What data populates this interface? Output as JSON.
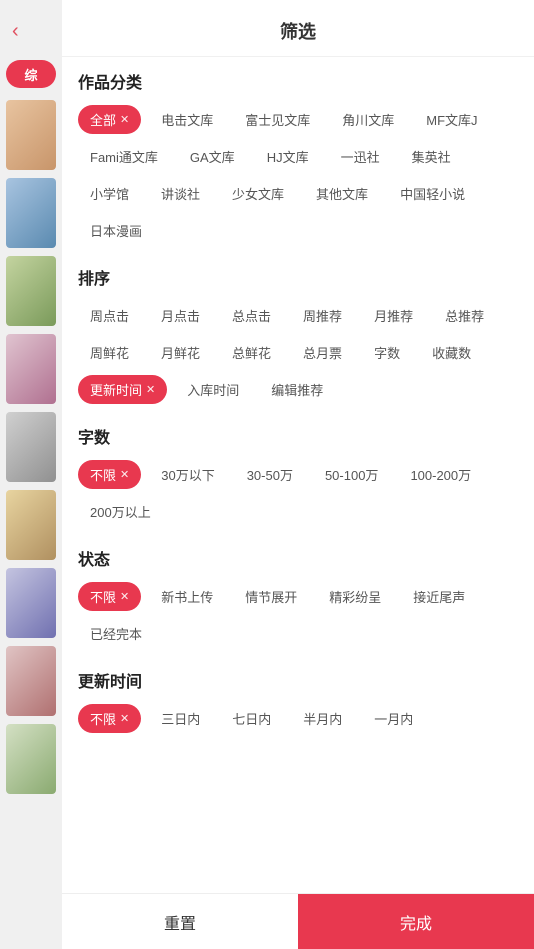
{
  "header": {
    "title": "筛选",
    "back_icon": "‹"
  },
  "sections": {
    "category": {
      "title": "作品分类",
      "tags": [
        {
          "label": "全部",
          "active": true,
          "showClose": true
        },
        {
          "label": "电击文库",
          "active": false
        },
        {
          "label": "富士见文库",
          "active": false
        },
        {
          "label": "角川文库",
          "active": false
        },
        {
          "label": "MF文库J",
          "active": false
        },
        {
          "label": "Fami通文库",
          "active": false
        },
        {
          "label": "GA文库",
          "active": false
        },
        {
          "label": "HJ文库",
          "active": false
        },
        {
          "label": "一迅社",
          "active": false
        },
        {
          "label": "集英社",
          "active": false
        },
        {
          "label": "小学馆",
          "active": false
        },
        {
          "label": "讲谈社",
          "active": false
        },
        {
          "label": "少女文库",
          "active": false
        },
        {
          "label": "其他文库",
          "active": false
        },
        {
          "label": "中国轻小说",
          "active": false
        },
        {
          "label": "日本漫画",
          "active": false
        }
      ]
    },
    "sort": {
      "title": "排序",
      "tags": [
        {
          "label": "周点击",
          "active": false
        },
        {
          "label": "月点击",
          "active": false
        },
        {
          "label": "总点击",
          "active": false
        },
        {
          "label": "周推荐",
          "active": false
        },
        {
          "label": "月推荐",
          "active": false
        },
        {
          "label": "总推荐",
          "active": false
        },
        {
          "label": "周鲜花",
          "active": false
        },
        {
          "label": "月鲜花",
          "active": false
        },
        {
          "label": "总鲜花",
          "active": false
        },
        {
          "label": "总月票",
          "active": false
        },
        {
          "label": "字数",
          "active": false
        },
        {
          "label": "收藏数",
          "active": false
        },
        {
          "label": "更新时间",
          "active": true,
          "showClose": true
        },
        {
          "label": "入库时间",
          "active": false
        },
        {
          "label": "编辑推荐",
          "active": false
        }
      ]
    },
    "wordcount": {
      "title": "字数",
      "tags": [
        {
          "label": "不限",
          "active": true,
          "showClose": true
        },
        {
          "label": "30万以下",
          "active": false
        },
        {
          "label": "30-50万",
          "active": false
        },
        {
          "label": "50-100万",
          "active": false
        },
        {
          "label": "100-200万",
          "active": false
        },
        {
          "label": "200万以上",
          "active": false
        }
      ]
    },
    "status": {
      "title": "状态",
      "tags": [
        {
          "label": "不限",
          "active": true,
          "showClose": true
        },
        {
          "label": "新书上传",
          "active": false
        },
        {
          "label": "情节展开",
          "active": false
        },
        {
          "label": "精彩纷呈",
          "active": false
        },
        {
          "label": "接近尾声",
          "active": false
        },
        {
          "label": "已经完本",
          "active": false
        }
      ]
    },
    "updatetime": {
      "title": "更新时间",
      "tags": [
        {
          "label": "不限",
          "active": true,
          "showClose": true
        },
        {
          "label": "三日内",
          "active": false
        },
        {
          "label": "七日内",
          "active": false
        },
        {
          "label": "半月内",
          "active": false
        },
        {
          "label": "一月内",
          "active": false
        }
      ]
    }
  },
  "footer": {
    "reset_label": "重置",
    "confirm_label": "完成"
  },
  "sidebar": {
    "active_label": "综",
    "books": [
      "b1",
      "b2",
      "b3",
      "b4",
      "b5",
      "b6",
      "b7",
      "b8",
      "b9"
    ]
  }
}
